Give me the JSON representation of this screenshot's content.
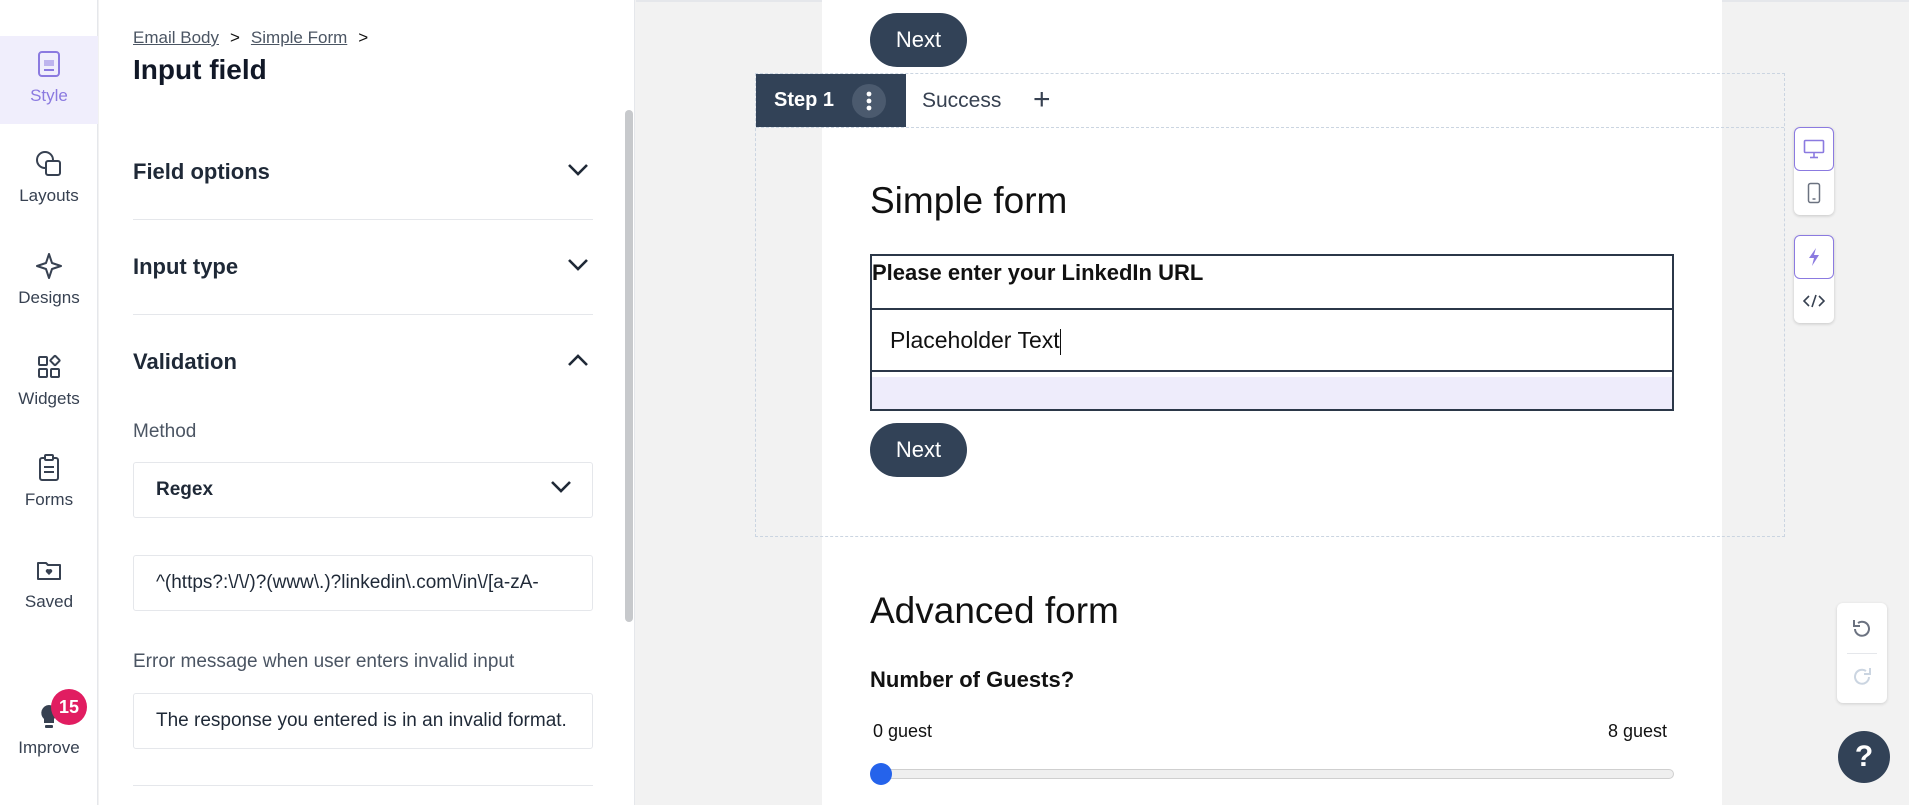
{
  "rail": {
    "items": [
      {
        "label": "Style",
        "icon": "style-icon"
      },
      {
        "label": "Layouts",
        "icon": "layouts-icon"
      },
      {
        "label": "Designs",
        "icon": "designs-icon"
      },
      {
        "label": "Widgets",
        "icon": "widgets-icon"
      },
      {
        "label": "Forms",
        "icon": "forms-icon"
      },
      {
        "label": "Saved",
        "icon": "saved-icon"
      },
      {
        "label": "Improve",
        "icon": "lightbulb-icon"
      }
    ],
    "improve_count": "15"
  },
  "panel": {
    "breadcrumb": [
      "Email Body",
      "Simple Form"
    ],
    "breadcrumb_sep": ">",
    "title": "Input field",
    "sections": {
      "field_options": "Field options",
      "input_type": "Input type",
      "validation": "Validation"
    },
    "method_label": "Method",
    "method_value": "Regex",
    "regex_value": "^(https?:\\/\\/)?(www\\.)?linkedin\\.com\\/in\\/[a-zA-",
    "error_label": "Error message when user enters invalid input",
    "error_value": "The response you entered is in an invalid format."
  },
  "canvas": {
    "next_label": "Next",
    "tabs": {
      "step1": "Step 1",
      "success": "Success",
      "add": "+"
    },
    "simple_form_title": "Simple form",
    "question_label": "Please enter your LinkedIn URL",
    "input_value": "Placeholder Text",
    "advanced_form_title": "Advanced form",
    "guests_label": "Number of Guests?",
    "guests_min": "0 guest",
    "guests_max": "8 guest",
    "guests_value": 0
  },
  "toolbar": {
    "help_label": "?"
  },
  "colors": {
    "accent": "#8b7ae0",
    "button_dark": "#324257",
    "badge": "#e11d61"
  }
}
